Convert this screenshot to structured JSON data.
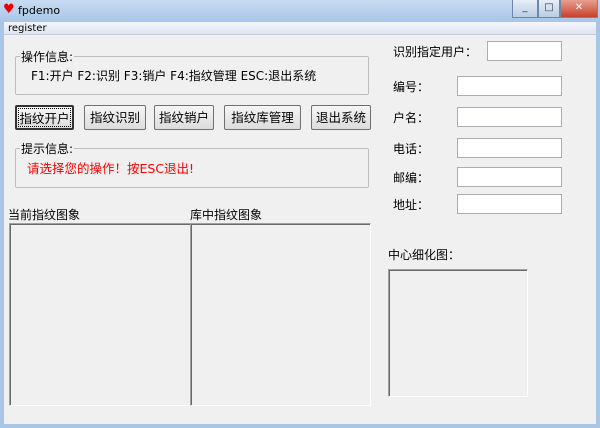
{
  "window": {
    "title": "fpdemo",
    "menu": [
      "register"
    ],
    "controls": [
      "minimize",
      "maximize",
      "close"
    ]
  },
  "operation_info": {
    "label": "操作信息:",
    "text": "F1:开户 F2:识别 F3:销户 F4:指纹管理 ESC:退出系统"
  },
  "buttons": [
    "指纹开户",
    "指纹识别",
    "指纹销户",
    "指纹库管理",
    "退出系统"
  ],
  "prompt_info": {
    "label": "提示信息:",
    "text": "请选择您的操作！按ESC退出!",
    "color": "#ff0000"
  },
  "images": {
    "current_label": "当前指纹图象",
    "library_label": "库中指纹图象",
    "center_label": "中心细化图："
  },
  "user_form": {
    "identify_label": "识别指定用户：",
    "identify_value": "",
    "fields": [
      {
        "label": "编号：",
        "value": ""
      },
      {
        "label": "户名：",
        "value": ""
      },
      {
        "label": "电话：",
        "value": ""
      },
      {
        "label": "邮编：",
        "value": ""
      },
      {
        "label": "地址：",
        "value": ""
      }
    ]
  }
}
